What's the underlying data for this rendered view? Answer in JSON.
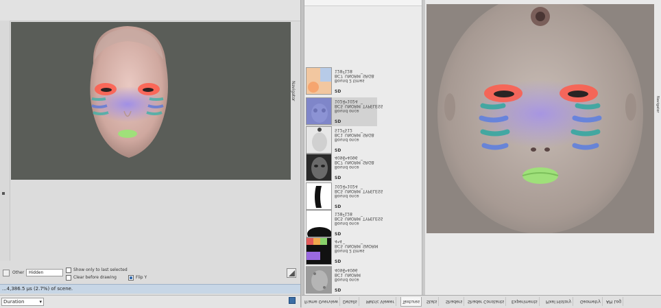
{
  "left_panel": {
    "side_tab_label": "Navigator",
    "options": {
      "other_label": "Other",
      "other_value": "Hidden",
      "show_only_label": "Show only to last selected",
      "clear_label": "Clear before drawing",
      "flip_label": "Flip Y"
    },
    "status_text": "...4,386.5 µs (2.7%) of scene.",
    "bottom_combo_value": "Duration"
  },
  "texture_list": {
    "items": [
      {
        "lines": [
          "Bound 2 times",
          "BC7_UNORM_SRGB",
          "128*128"
        ],
        "sd": "SD",
        "thumb": "peach-blue"
      },
      {
        "lines": [
          "Bound once",
          "BC5_UNORM_TYPELESS",
          "1024*1024"
        ],
        "sd": "SD",
        "thumb": "normal-blue",
        "selected": true
      },
      {
        "lines": [
          "Bound once",
          "BC1_UNORM_SRGB",
          "512*512"
        ],
        "sd": "SD",
        "thumb": "grey-face"
      },
      {
        "lines": [
          "Bound once",
          "BC7_UNORM_SRGB",
          "4096*4096"
        ],
        "sd": "SD",
        "thumb": "dark-face"
      },
      {
        "lines": [
          "Bound once",
          "BC5_UNORM_TYPELESS",
          "1024*1024"
        ],
        "sd": "SD",
        "thumb": "silhouette"
      },
      {
        "lines": [
          "Bound once",
          "BC5_UNORM_TYPELESS",
          "128*128"
        ],
        "sd": "SD",
        "thumb": "white-mask"
      },
      {
        "lines": [
          "Bound 2 times",
          "BC5_UNORM_SNORM",
          "4*4"
        ],
        "sd": "SD",
        "thumb": "palette"
      },
      {
        "lines": [
          "Bound once",
          "BC1_UNORM",
          "4096*4096"
        ],
        "sd": "SD",
        "thumb": "noise-grey"
      }
    ]
  },
  "right_panel": {
    "side_tab_label": "Navigator"
  },
  "tabs": [
    "Frame Overview",
    "Details",
    "Metric Viewer",
    "Textures",
    "Stats",
    "Shaders",
    "Shader Constants",
    "Experiments",
    "Pixel History",
    "Geometry",
    "API Log"
  ],
  "colors": {
    "viewport_bg": "#5a5d58",
    "texture_bg": "#8d8580",
    "status_bg": "#c7d6e6",
    "accent": "#3d6ea5"
  }
}
